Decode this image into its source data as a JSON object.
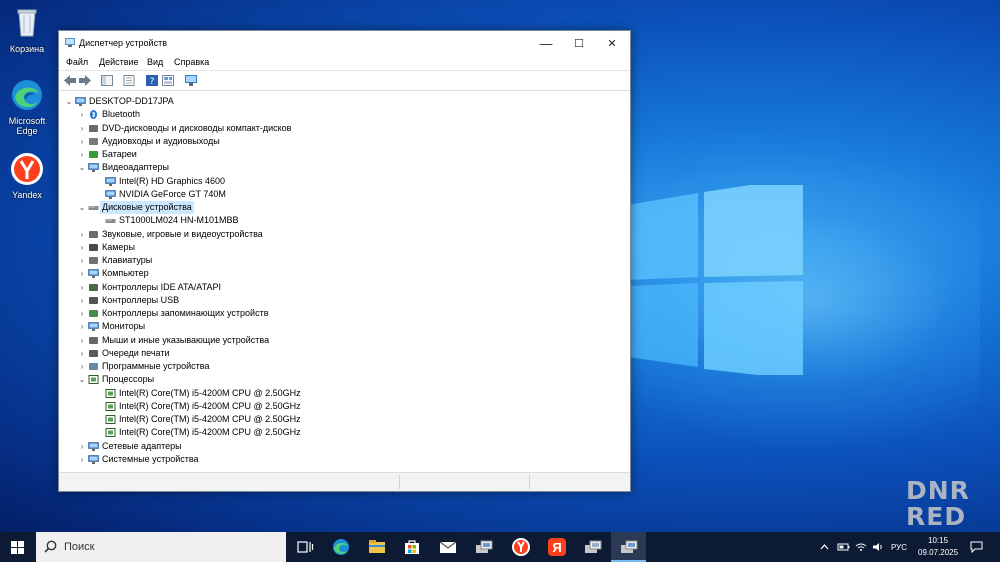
{
  "desktop": {
    "icons": [
      {
        "label": "Корзина"
      },
      {
        "label": "Microsoft Edge"
      },
      {
        "label": "Yandex"
      }
    ],
    "watermark_line1": "DNR",
    "watermark_line2": "RED"
  },
  "window": {
    "title": "Диспетчер устройств",
    "controls": {
      "minimize": "—",
      "maximize": "☐",
      "close": "✕"
    },
    "menu": [
      "Файл",
      "Действие",
      "Вид",
      "Справка"
    ],
    "tree": {
      "root": "DESKTOP-DD17JPA",
      "categories": [
        {
          "label": "Bluetooth",
          "expanded": false
        },
        {
          "label": "DVD-дисководы и дисководы компакт-дисков",
          "expanded": false
        },
        {
          "label": "Аудиовходы и аудиовыходы",
          "expanded": false
        },
        {
          "label": "Батареи",
          "expanded": false
        },
        {
          "label": "Видеоадаптеры",
          "expanded": true,
          "children": [
            "Intel(R) HD Graphics 4600",
            "NVIDIA GeForce GT 740M"
          ]
        },
        {
          "label": "Дисковые устройства",
          "expanded": true,
          "selected": true,
          "children": [
            "ST1000LM024 HN-M101MBB"
          ]
        },
        {
          "label": "Звуковые, игровые и видеоустройства",
          "expanded": false
        },
        {
          "label": "Камеры",
          "expanded": false
        },
        {
          "label": "Клавиатуры",
          "expanded": false
        },
        {
          "label": "Компьютер",
          "expanded": false
        },
        {
          "label": "Контроллеры IDE ATA/ATAPI",
          "expanded": false
        },
        {
          "label": "Контроллеры USB",
          "expanded": false
        },
        {
          "label": "Контроллеры запоминающих устройств",
          "expanded": false
        },
        {
          "label": "Мониторы",
          "expanded": false
        },
        {
          "label": "Мыши и иные указывающие устройства",
          "expanded": false
        },
        {
          "label": "Очереди печати",
          "expanded": false
        },
        {
          "label": "Программные устройства",
          "expanded": false
        },
        {
          "label": "Процессоры",
          "expanded": true,
          "children": [
            "Intel(R) Core(TM) i5-4200M CPU @ 2.50GHz",
            "Intel(R) Core(TM) i5-4200M CPU @ 2.50GHz",
            "Intel(R) Core(TM) i5-4200M CPU @ 2.50GHz",
            "Intel(R) Core(TM) i5-4200M CPU @ 2.50GHz"
          ]
        },
        {
          "label": "Сетевые адаптеры",
          "expanded": false
        },
        {
          "label": "Системные устройства",
          "expanded": false
        }
      ]
    }
  },
  "taskbar": {
    "search_placeholder": "Поиск",
    "language": "РУС",
    "time": "10:15",
    "date": "09.07.2025"
  },
  "colors": {
    "accent": "#0078d7",
    "selection": "#cce8ff",
    "taskbar": "#0c1a33"
  }
}
